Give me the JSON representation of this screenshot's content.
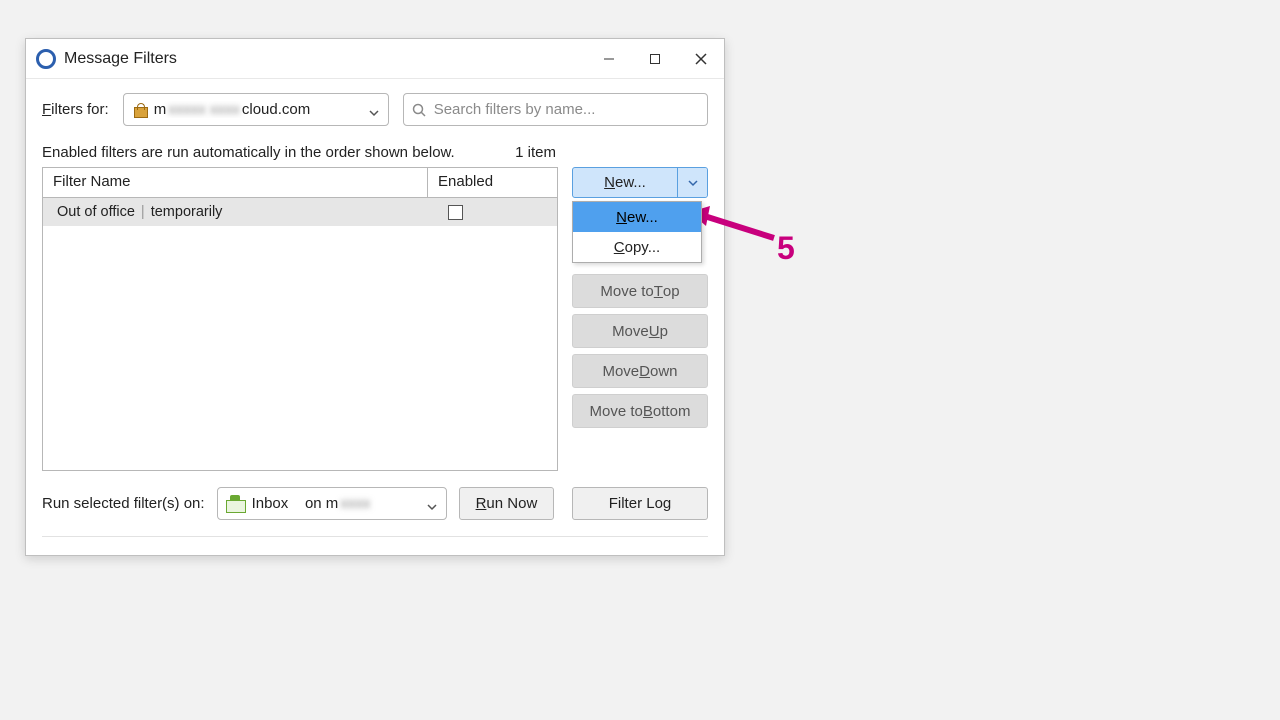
{
  "window": {
    "title": "Message Filters"
  },
  "filters_for": {
    "label_pre": "F",
    "label_post": "ilters for:",
    "account_prefix": "m",
    "account_middle": "xxxxx xxxx",
    "account_suffix": "cloud.com"
  },
  "search": {
    "placeholder": "Search filters by name..."
  },
  "info": {
    "text": "Enabled filters are run automatically in the order shown below.",
    "count": "1 item"
  },
  "table": {
    "headers": {
      "name": "Filter Name",
      "enabled": "Enabled"
    },
    "rows": [
      {
        "part1": "Out of office",
        "part2": "temporarily",
        "enabled": false
      }
    ]
  },
  "buttons": {
    "new_pre": "N",
    "new_post": "ew...",
    "menu_new_pre": "N",
    "menu_new_post": "ew...",
    "menu_copy_pre": "C",
    "menu_copy_post": "opy...",
    "move_top_pre": "Move to ",
    "move_top_u": "T",
    "move_top_post": "op",
    "move_up_pre": "Move ",
    "move_up_u": "U",
    "move_up_post": "p",
    "move_down_pre": "Move ",
    "move_down_u": "D",
    "move_down_post": "own",
    "move_bottom_pre": "Move to ",
    "move_bottom_u": "B",
    "move_bottom_post": "ottom",
    "run_now_pre": "R",
    "run_now_post": "un Now",
    "filter_log": "Filter Log"
  },
  "run_on": {
    "label": "Run selected filter(s) on:",
    "folder": "Inbox",
    "on_text": "on m",
    "on_blur": "xxxx"
  },
  "annotation": {
    "number": "5"
  }
}
